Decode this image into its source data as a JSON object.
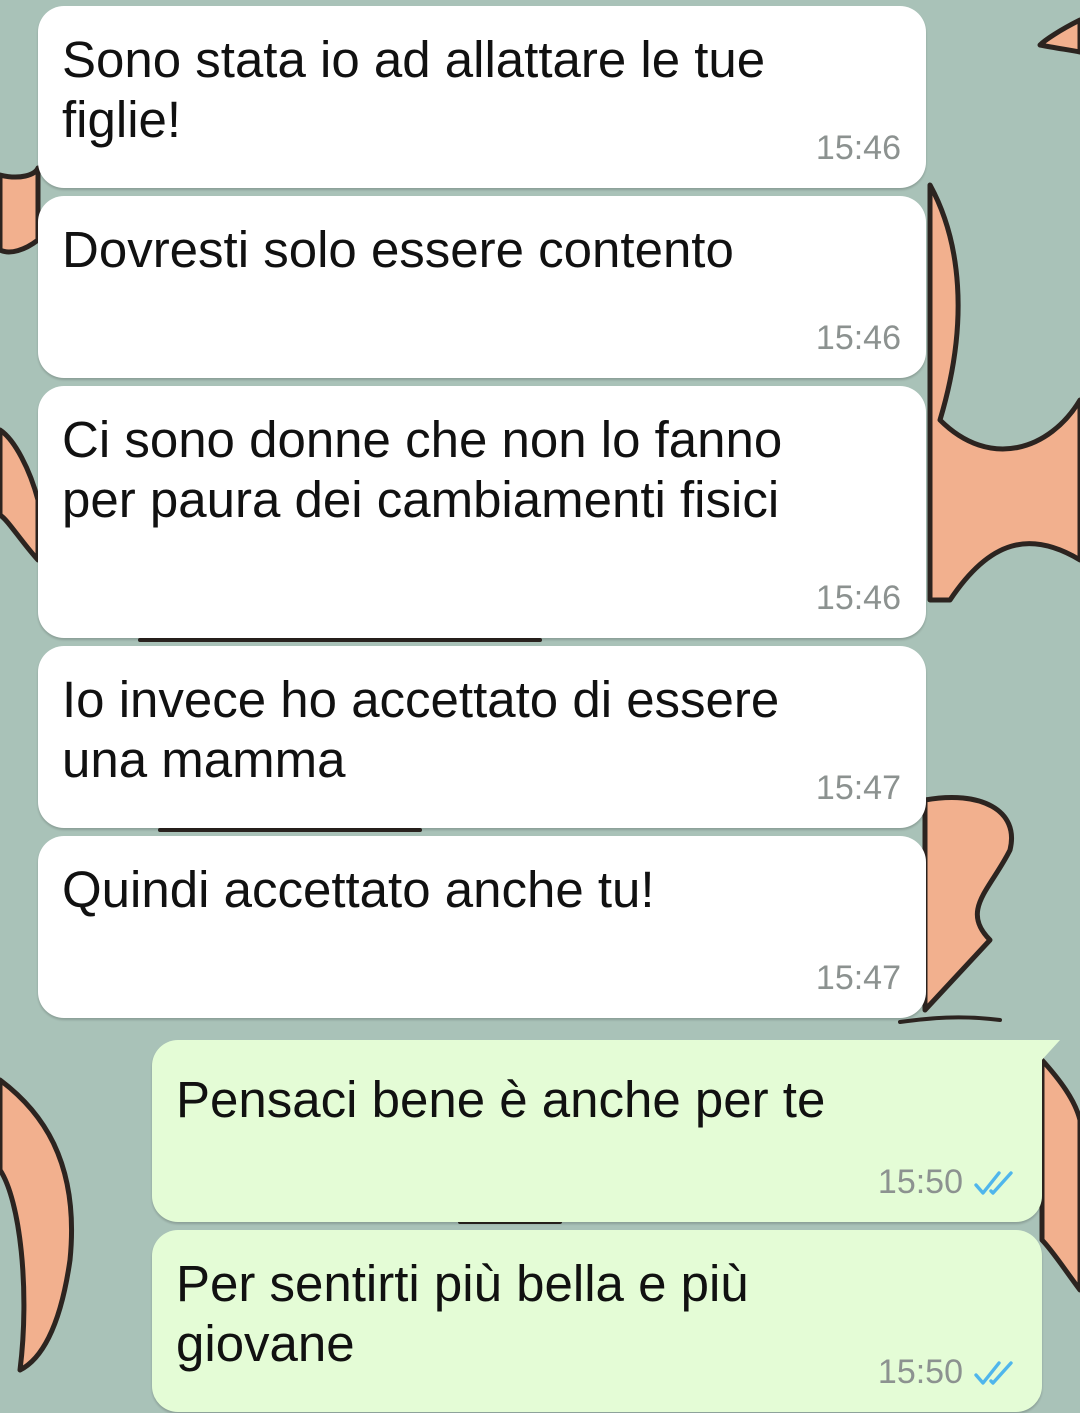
{
  "colors": {
    "wallpaper": "#a9c2b8",
    "incoming_bubble": "#ffffff",
    "outgoing_bubble": "#e4fcd6",
    "timestamp": "#8c9290",
    "read_ticks": "#4fb6ec"
  },
  "messages": [
    {
      "direction": "incoming",
      "text": "Sono stata io ad allattare le tue\nfiglie!",
      "time": "15:46"
    },
    {
      "direction": "incoming",
      "text": "Dovresti solo essere contento",
      "time": "15:46"
    },
    {
      "direction": "incoming",
      "text": "Ci sono donne che non lo fanno\nper paura dei cambiamenti fisici",
      "time": "15:46"
    },
    {
      "direction": "incoming",
      "text": "Io invece ho accettato di essere\nuna mamma",
      "time": "15:47"
    },
    {
      "direction": "incoming",
      "text": "Quindi accettato anche tu!",
      "time": "15:47"
    },
    {
      "direction": "outgoing",
      "text": "Pensaci bene è anche per te",
      "time": "15:50",
      "status": "read-double-tick-icon"
    },
    {
      "direction": "outgoing",
      "text": "Per sentirti più bella e più\ngiovane",
      "time": "15:50",
      "status": "read-double-tick-icon"
    }
  ]
}
